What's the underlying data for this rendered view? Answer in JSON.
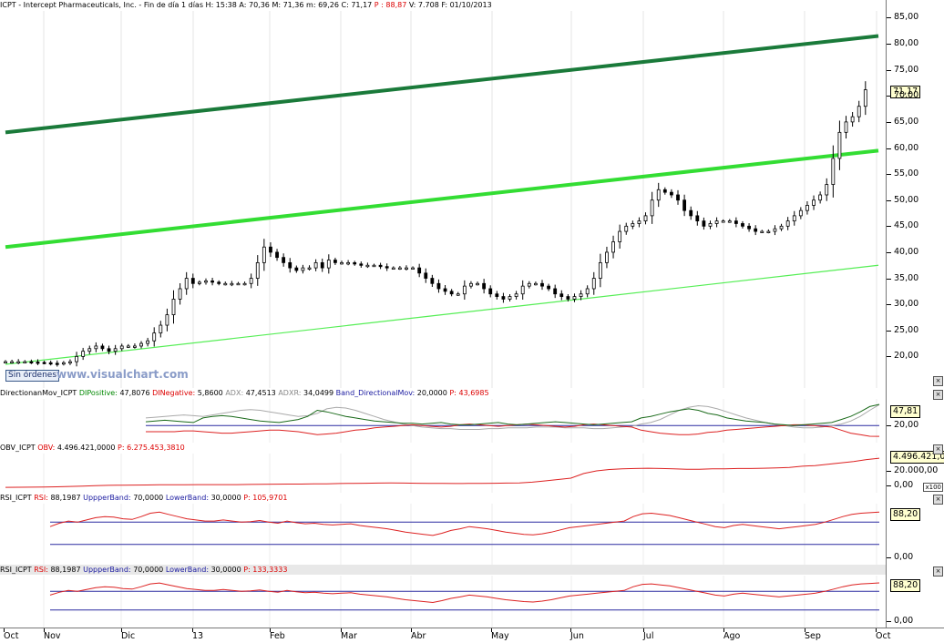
{
  "main": {
    "header": {
      "symbol": "ICPT",
      "name": "Intercept Pharmaceuticals, Inc.",
      "period": "Fin de día 1 días",
      "hour": "H: 15:38",
      "open": "A: 70,36",
      "high": "M: 71,36",
      "low": "m: 69,26",
      "close": "C: 71,17",
      "p": "P : 88,87",
      "volume": "V: 7.708",
      "date": "F: 01/10/2013"
    },
    "last_value": "71,17",
    "no_orders": "Sin órdenes",
    "brand": "www.visualchart.com"
  },
  "indicators": {
    "dmi": {
      "name": "DirectionanMov_ICPT",
      "dip_label": "DIPositive:",
      "dip": "47,8076",
      "din_label": "DINegative:",
      "din": "5,8600",
      "adx_label": "ADX:",
      "adx": "47,4513",
      "adxr_label": "ADXR:",
      "adxr": "34,0499",
      "band_label": "Band_DirectionalMov:",
      "band": "20,0000",
      "p": "P: 43,6985",
      "last": "47,81",
      "tick": "20,00"
    },
    "obv": {
      "name": "OBV_ICPT",
      "label": "OBV:",
      "value": "4.496.421,0000",
      "p": "P: 6.275.453,3810",
      "last": "4.496.421,0",
      "tick1": "20.000,00",
      "tick0": "0,00",
      "mult": "x100"
    },
    "rsi1": {
      "name": "RSI_ICPT",
      "label": "RSI:",
      "value": "88,1987",
      "ub_label": "UppperBand:",
      "ub": "70,0000",
      "lb_label": "LowerBand:",
      "lb": "30,0000",
      "p": "P: 105,9701",
      "last": "88,20",
      "tick0": "0,00"
    },
    "rsi2": {
      "name": "RSI_ICPT",
      "label": "RSI:",
      "value": "88,1987",
      "ub_label": "UppperBand:",
      "ub": "70,0000",
      "lb_label": "LowerBand:",
      "lb": "30,0000",
      "p": "P: 133,3333",
      "last": "88,20",
      "tick0": "0,00"
    }
  },
  "time_axis": [
    "Oct",
    "Nov",
    "Dic",
    "13",
    "Feb",
    "Mar",
    "Abr",
    "May",
    "Jun",
    "Jul",
    "Ago",
    "Sep",
    "Oct"
  ],
  "chart_data": [
    {
      "type": "candlestick",
      "title": "ICPT - Intercept Pharmaceuticals, Inc.",
      "ylim": [
        15,
        87
      ],
      "yticks": [
        "20,00",
        "25,00",
        "30,00",
        "35,00",
        "40,00",
        "45,00",
        "50,00",
        "55,00",
        "60,00",
        "65,00",
        "70,00",
        "75,00",
        "80,00",
        "85,00"
      ],
      "series": [
        {
          "values": [
            [
              0,
              19
            ],
            [
              3,
              19
            ],
            [
              6,
              18.8
            ],
            [
              8,
              18.6
            ],
            [
              10,
              19
            ],
            [
              12,
              21
            ],
            [
              14,
              22
            ],
            [
              16,
              21
            ],
            [
              18,
              22
            ],
            [
              20,
              22
            ],
            [
              22,
              23
            ],
            [
              24,
              26
            ],
            [
              25,
              28
            ],
            [
              26,
              31
            ],
            [
              27,
              33
            ],
            [
              28,
              35
            ],
            [
              29,
              34
            ],
            [
              31,
              34.5
            ],
            [
              33,
              34
            ],
            [
              35,
              34
            ],
            [
              37,
              34
            ],
            [
              38,
              35
            ],
            [
              39,
              38
            ],
            [
              40,
              41
            ],
            [
              41,
              40
            ],
            [
              42,
              39
            ],
            [
              43,
              38
            ],
            [
              44,
              37
            ],
            [
              45,
              36.5
            ],
            [
              46,
              37
            ],
            [
              47,
              37
            ],
            [
              48,
              38
            ],
            [
              49,
              37
            ],
            [
              50,
              38.5
            ],
            [
              51,
              38
            ],
            [
              53,
              38
            ],
            [
              55,
              37.5
            ],
            [
              57,
              37.5
            ],
            [
              59,
              37
            ],
            [
              61,
              37
            ],
            [
              63,
              37
            ],
            [
              64,
              36
            ],
            [
              65,
              35
            ],
            [
              66,
              34
            ],
            [
              67,
              33
            ],
            [
              68,
              32.5
            ],
            [
              69,
              32
            ],
            [
              70,
              32
            ],
            [
              71,
              33.5
            ],
            [
              72,
              34
            ],
            [
              73,
              34
            ],
            [
              74,
              33
            ],
            [
              75,
              32
            ],
            [
              76,
              31.5
            ],
            [
              77,
              31
            ],
            [
              78,
              31.5
            ],
            [
              79,
              32
            ],
            [
              80,
              33.5
            ],
            [
              81,
              34
            ],
            [
              82,
              34
            ],
            [
              83,
              33.5
            ],
            [
              84,
              33
            ],
            [
              85,
              32
            ],
            [
              86,
              31.5
            ],
            [
              87,
              31
            ],
            [
              88,
              31.5
            ],
            [
              89,
              32
            ],
            [
              90,
              33
            ],
            [
              91,
              35
            ],
            [
              92,
              38
            ],
            [
              93,
              40
            ],
            [
              94,
              42
            ],
            [
              95,
              44
            ],
            [
              96,
              45
            ],
            [
              97,
              45.5
            ],
            [
              98,
              46
            ],
            [
              99,
              47
            ],
            [
              100,
              50
            ],
            [
              101,
              52
            ],
            [
              102,
              51.5
            ],
            [
              103,
              51
            ],
            [
              104,
              50
            ],
            [
              105,
              48
            ],
            [
              106,
              47
            ],
            [
              107,
              46
            ],
            [
              108,
              45
            ],
            [
              109,
              45.5
            ],
            [
              110,
              46
            ],
            [
              111,
              46
            ],
            [
              112,
              46
            ],
            [
              113,
              45.5
            ],
            [
              114,
              45
            ],
            [
              115,
              44.5
            ],
            [
              116,
              44
            ],
            [
              117,
              44
            ],
            [
              118,
              44
            ],
            [
              119,
              44.5
            ],
            [
              120,
              45
            ],
            [
              121,
              46
            ],
            [
              122,
              47
            ],
            [
              123,
              48
            ],
            [
              124,
              49
            ],
            [
              125,
              50
            ],
            [
              126,
              51
            ],
            [
              127,
              53
            ],
            [
              128,
              58
            ],
            [
              129,
              63
            ],
            [
              130,
              65
            ],
            [
              131,
              66
            ],
            [
              132,
              68
            ],
            [
              133,
              71.17
            ]
          ]
        }
      ],
      "trendlines": [
        {
          "from": [
            0,
            63
          ],
          "to": [
            135,
            81.5
          ],
          "style": "dark-green-thick"
        },
        {
          "from": [
            0,
            41
          ],
          "to": [
            135,
            59.5
          ],
          "style": "bright-green-thick"
        },
        {
          "from": [
            0,
            18.5
          ],
          "to": [
            135,
            37.5
          ],
          "style": "light-green-thin"
        }
      ]
    },
    {
      "type": "line",
      "title": "DirectionanMov_ICPT",
      "ylim": [
        0,
        55
      ],
      "band": 20,
      "series": [
        {
          "name": "DIPositive",
          "values": [
            25,
            26,
            27,
            26,
            25,
            24,
            30,
            32,
            33,
            32,
            30,
            28,
            26,
            25,
            24,
            26,
            28,
            32,
            40,
            38,
            35,
            32,
            30,
            28,
            26,
            25,
            24,
            23,
            23,
            22,
            23,
            24,
            22,
            21,
            21,
            22,
            23,
            24,
            22,
            21,
            22,
            23,
            24,
            25,
            24,
            23,
            22,
            21,
            22,
            23,
            24,
            25,
            30,
            32,
            35,
            38,
            40,
            42,
            40,
            36,
            34,
            30,
            28,
            26,
            25,
            24,
            22,
            21,
            20,
            21,
            22,
            23,
            24,
            28,
            32,
            38,
            45,
            47.8
          ]
        },
        {
          "name": "DINegative",
          "values": [
            12,
            12,
            12,
            12,
            13,
            13,
            12,
            11,
            10,
            10,
            11,
            12,
            13,
            14,
            14,
            13,
            12,
            10,
            8,
            9,
            10,
            12,
            14,
            15,
            17,
            18,
            19,
            20,
            21,
            20,
            19,
            18,
            19,
            21,
            22,
            21,
            20,
            19,
            20,
            21,
            22,
            21,
            20,
            19,
            18,
            19,
            21,
            22,
            21,
            20,
            19,
            18,
            14,
            12,
            10,
            9,
            8,
            8,
            9,
            11,
            12,
            14,
            15,
            16,
            17,
            18,
            19,
            20,
            21,
            21,
            20,
            19,
            18,
            14,
            10,
            8,
            6,
            5.86
          ]
        },
        {
          "name": "ADX",
          "values": [
            30,
            31,
            32,
            33,
            34,
            33,
            32,
            34,
            36,
            38,
            40,
            41,
            40,
            38,
            36,
            34,
            32,
            33,
            36,
            42,
            44,
            43,
            40,
            36,
            32,
            28,
            25,
            22,
            20,
            18,
            17,
            16,
            16,
            15,
            15,
            15,
            16,
            16,
            17,
            17,
            17,
            18,
            18,
            18,
            17,
            17,
            17,
            16,
            16,
            17,
            18,
            19,
            22,
            24,
            28,
            34,
            40,
            44,
            46,
            45,
            42,
            38,
            34,
            30,
            27,
            24,
            22,
            20,
            18,
            17,
            17,
            18,
            20,
            22,
            26,
            32,
            40,
            47.45
          ]
        }
      ]
    },
    {
      "type": "line",
      "title": "OBV_ICPT",
      "series": [
        {
          "name": "OBV",
          "values": [
            120000,
            140000,
            150000,
            170000,
            210000,
            260000,
            320000,
            380000,
            420000,
            450000,
            470000,
            480000,
            500000,
            510000,
            520000,
            530000,
            540000,
            530000,
            540000,
            560000,
            580000,
            600000,
            610000,
            620000,
            640000,
            660000,
            700000,
            720000,
            740000,
            760000,
            780000,
            760000,
            740000,
            730000,
            720000,
            700000,
            710000,
            720000,
            740000,
            760000,
            800000,
            900000,
            1100000,
            1300000,
            1500000,
            2200000,
            2600000,
            2800000,
            2900000,
            2950000,
            3000000,
            2950000,
            2900000,
            2850000,
            2850000,
            2900000,
            2900000,
            2950000,
            2950000,
            3000000,
            3050000,
            3100000,
            3300000,
            3400000,
            3600000,
            3800000,
            4000000,
            4300000,
            4496421
          ]
        }
      ]
    },
    {
      "type": "line",
      "title": "RSI_ICPT",
      "ylim": [
        0,
        100
      ],
      "bands": [
        70,
        30
      ],
      "series": [
        {
          "name": "RSI",
          "values": [
            62,
            68,
            72,
            70,
            74,
            78,
            80,
            79,
            76,
            75,
            80,
            86,
            88,
            84,
            80,
            76,
            74,
            72,
            72,
            74,
            72,
            70,
            71,
            73,
            70,
            68,
            72,
            69,
            67,
            68,
            66,
            65,
            66,
            67,
            64,
            62,
            60,
            58,
            55,
            52,
            50,
            48,
            46,
            50,
            55,
            58,
            62,
            60,
            58,
            55,
            52,
            50,
            48,
            47,
            49,
            52,
            56,
            60,
            62,
            64,
            66,
            68,
            70,
            72,
            80,
            85,
            86,
            84,
            82,
            78,
            74,
            70,
            66,
            62,
            60,
            64,
            66,
            64,
            62,
            60,
            58,
            60,
            62,
            64,
            66,
            70,
            75,
            80,
            84,
            86,
            87,
            88.2
          ]
        }
      ]
    },
    {
      "type": "line",
      "title": "RSI_ICPT",
      "ylim": [
        0,
        100
      ],
      "bands": [
        70,
        30
      ],
      "series": [
        {
          "name": "RSI",
          "values": [
            62,
            68,
            72,
            70,
            74,
            78,
            80,
            79,
            76,
            75,
            80,
            86,
            88,
            84,
            80,
            76,
            74,
            72,
            72,
            74,
            72,
            70,
            71,
            73,
            70,
            68,
            72,
            69,
            67,
            68,
            66,
            65,
            66,
            67,
            64,
            62,
            60,
            58,
            55,
            52,
            50,
            48,
            46,
            50,
            55,
            58,
            62,
            60,
            58,
            55,
            52,
            50,
            48,
            47,
            49,
            52,
            56,
            60,
            62,
            64,
            66,
            68,
            70,
            72,
            80,
            85,
            86,
            84,
            82,
            78,
            74,
            70,
            66,
            62,
            60,
            64,
            66,
            64,
            62,
            60,
            58,
            60,
            62,
            64,
            66,
            70,
            75,
            80,
            84,
            86,
            87,
            88.2
          ]
        }
      ]
    }
  ]
}
